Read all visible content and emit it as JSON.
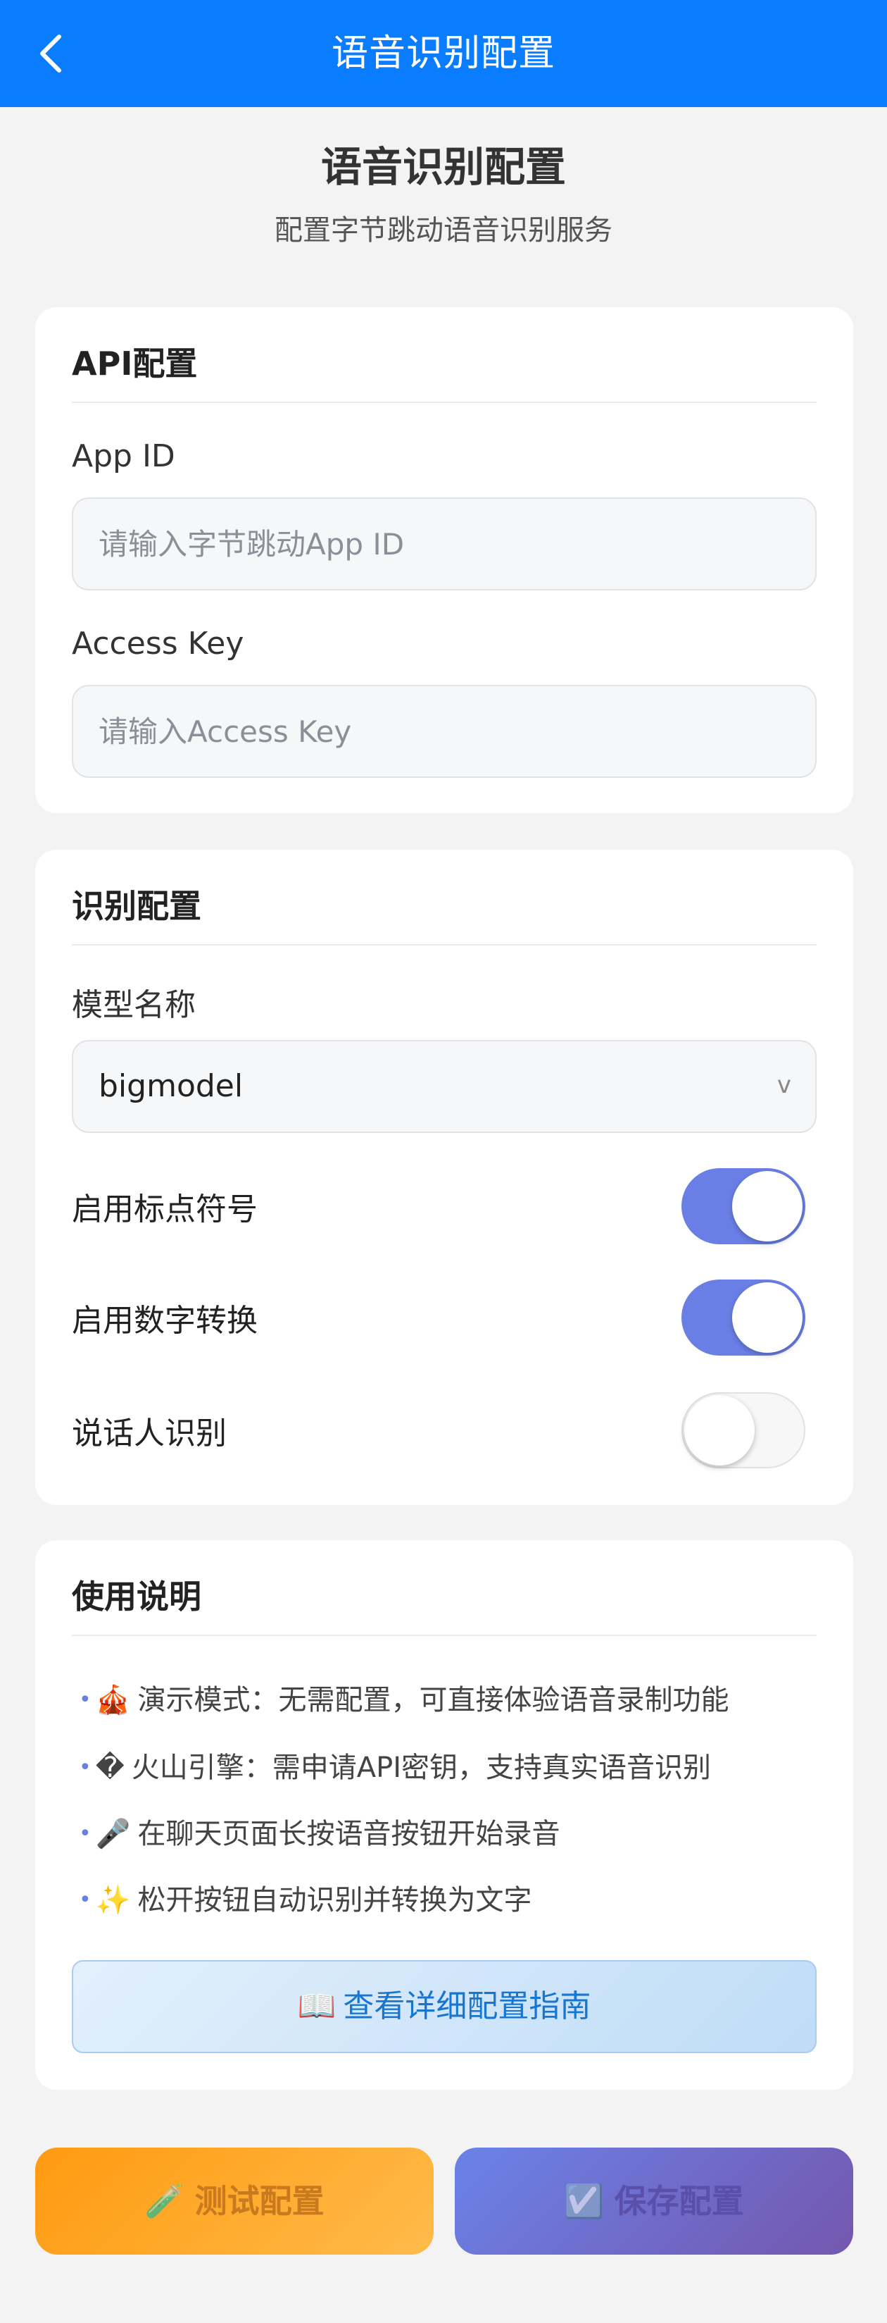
{
  "navbar": {
    "title": "语音识别配置"
  },
  "page": {
    "title": "语音识别配置",
    "subtitle": "配置字节跳动语音识别服务"
  },
  "api_card": {
    "title": "API配置",
    "app_id_label": "App ID",
    "app_id_value": "",
    "app_id_placeholder": "请输入字节跳动App ID",
    "access_key_label": "Access Key",
    "access_key_value": "",
    "access_key_placeholder": "请输入Access Key"
  },
  "recognition_card": {
    "title": "识别配置",
    "model_label": "模型名称",
    "model_value": "bigmodel",
    "model_arrow": "v",
    "toggles": [
      {
        "label": "启用标点符号",
        "on": true
      },
      {
        "label": "启用数字转换",
        "on": true
      },
      {
        "label": "说话人识别",
        "on": false
      }
    ]
  },
  "usage_card": {
    "title": "使用说明",
    "bullet": "•",
    "items": [
      {
        "icon": "🎪",
        "text": "演示模式：无需配置，可直接体验语音录制功能"
      },
      {
        "icon": "�",
        "text": "火山引擎：需申请API密钥，支持真实语音识别"
      },
      {
        "icon": "🎤",
        "text": "在聊天页面长按语音按钮开始录音"
      },
      {
        "icon": "✨",
        "text": "松开按钮自动识别并转换为文字"
      }
    ],
    "guide_button": {
      "icon": "📖",
      "label": "查看详细配置指南"
    }
  },
  "actions": {
    "test": {
      "icon": "🧪",
      "label": "测试配置"
    },
    "save": {
      "icon": "☑️",
      "label": "保存配置"
    }
  },
  "colors": {
    "navbar": "#0a7cff",
    "toggle_on": "#6a7fe6",
    "test_button": "#ff9a10",
    "save_button": "#6a82e8",
    "guide_text": "#1876d1"
  }
}
